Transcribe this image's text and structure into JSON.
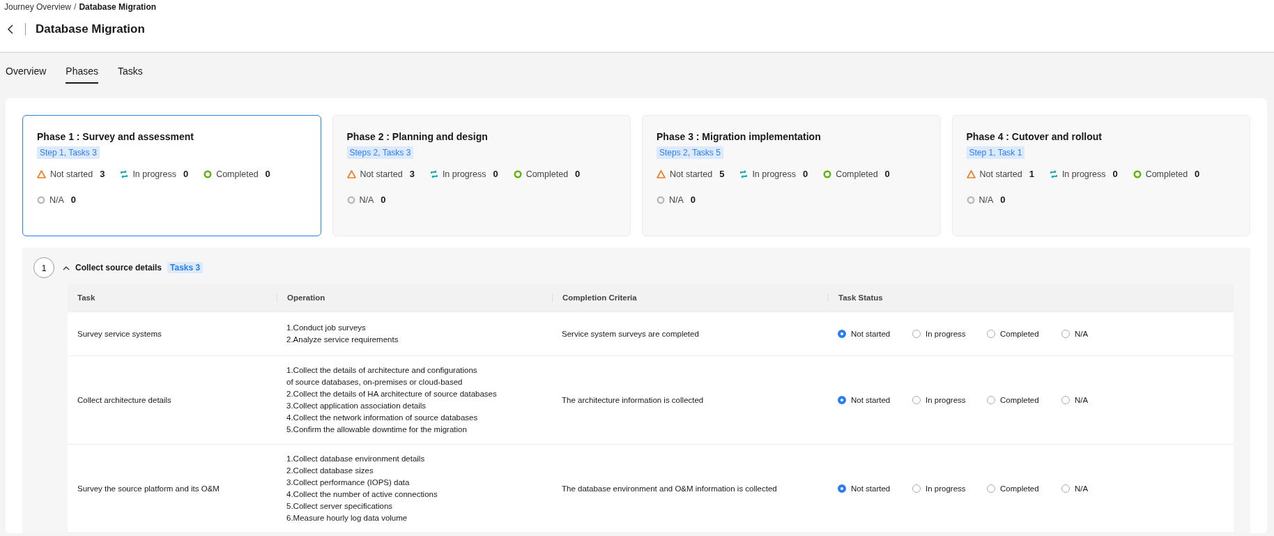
{
  "breadcrumb": {
    "parent": "Journey Overview",
    "separator": "/",
    "current": "Database Migration"
  },
  "page_title": "Database Migration",
  "tabs": [
    {
      "label": "Overview",
      "selected": false
    },
    {
      "label": "Phases",
      "selected": true
    },
    {
      "label": "Tasks",
      "selected": false
    }
  ],
  "phases": [
    {
      "title": "Phase 1 : Survey and assessment",
      "tag": "Step 1, Tasks 3",
      "selected": true,
      "stats": [
        {
          "kind": "not_started",
          "label": "Not started",
          "count": "3"
        },
        {
          "kind": "in_progress",
          "label": "In progress",
          "count": "0"
        },
        {
          "kind": "completed",
          "label": "Completed",
          "count": "0"
        },
        {
          "kind": "na",
          "label": "N/A",
          "count": "0"
        }
      ]
    },
    {
      "title": "Phase 2 : Planning and design",
      "tag": "Steps 2, Tasks 3",
      "selected": false,
      "stats": [
        {
          "kind": "not_started",
          "label": "Not started",
          "count": "3"
        },
        {
          "kind": "in_progress",
          "label": "In progress",
          "count": "0"
        },
        {
          "kind": "completed",
          "label": "Completed",
          "count": "0"
        },
        {
          "kind": "na",
          "label": "N/A",
          "count": "0"
        }
      ]
    },
    {
      "title": "Phase 3 : Migration implementation",
      "tag": "Steps 2, Tasks 5",
      "selected": false,
      "stats": [
        {
          "kind": "not_started",
          "label": "Not started",
          "count": "5"
        },
        {
          "kind": "in_progress",
          "label": "In progress",
          "count": "0"
        },
        {
          "kind": "completed",
          "label": "Completed",
          "count": "0"
        },
        {
          "kind": "na",
          "label": "N/A",
          "count": "0"
        }
      ]
    },
    {
      "title": "Phase 4 : Cutover and rollout",
      "tag": "Step 1, Task 1",
      "selected": false,
      "stats": [
        {
          "kind": "not_started",
          "label": "Not started",
          "count": "1"
        },
        {
          "kind": "in_progress",
          "label": "In progress",
          "count": "0"
        },
        {
          "kind": "completed",
          "label": "Completed",
          "count": "0"
        },
        {
          "kind": "na",
          "label": "N/A",
          "count": "0"
        }
      ]
    }
  ],
  "step": {
    "number": "1",
    "title": "Collect source details",
    "tag": "Tasks 3",
    "expanded": true,
    "table": {
      "columns": [
        "Task",
        "Operation",
        "Completion Criteria",
        "Task Status"
      ],
      "rows": [
        {
          "task": "Survey service systems",
          "operation": [
            "1.Conduct job surveys",
            "2.Analyze service requirements"
          ],
          "criteria": "Service system surveys are completed",
          "status": [
            {
              "label": "Not started",
              "selected": true
            },
            {
              "label": "In progress",
              "selected": false
            },
            {
              "label": "Completed",
              "selected": false
            },
            {
              "label": "N/A",
              "selected": false
            }
          ]
        },
        {
          "task": "Collect architecture details",
          "operation": [
            "1.Collect the details of architecture and configurations",
            "of source databases, on-premises or cloud-based",
            "2.Collect the details of HA architecture of source databases",
            "3.Collect application association details",
            "4.Collect the network information of source databases",
            "5.Confirm the allowable downtime for the migration"
          ],
          "criteria": "The architecture information is collected",
          "status": [
            {
              "label": "Not started",
              "selected": true
            },
            {
              "label": "In progress",
              "selected": false
            },
            {
              "label": "Completed",
              "selected": false
            },
            {
              "label": "N/A",
              "selected": false
            }
          ]
        },
        {
          "task": "Survey the source platform and its O&M",
          "operation": [
            "1.Collect database environment details",
            "2.Collect database sizes",
            "3.Collect performance (IOPS) data",
            "4.Collect the number of active connections",
            "5.Collect server specifications",
            "6.Measure hourly log data volume"
          ],
          "criteria": "The database environment and O&M information is collected",
          "status": [
            {
              "label": "Not started",
              "selected": true
            },
            {
              "label": "In progress",
              "selected": false
            },
            {
              "label": "Completed",
              "selected": false
            },
            {
              "label": "N/A",
              "selected": false
            }
          ]
        }
      ]
    }
  }
}
